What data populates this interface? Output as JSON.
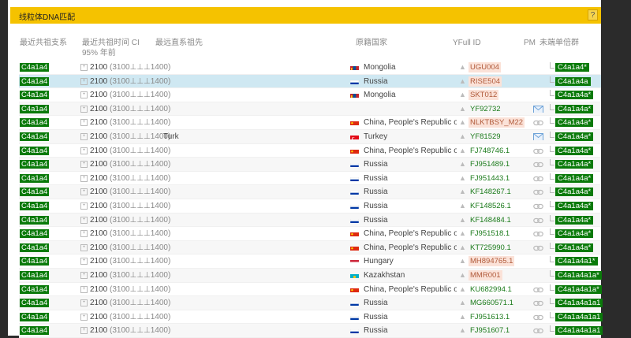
{
  "window": {
    "title": "线粒体DNA匹配",
    "help_label": "?"
  },
  "columns": {
    "haplogroup": "最近共祖支系",
    "tmrca_l1": "最近共祖时间 CI",
    "tmrca_l2": "95% 年前",
    "ancestor": "最远直系祖先",
    "country": "原籍国家",
    "yfull_id": "YFull ID",
    "pm": "PM",
    "subclade": "未端单倍群"
  },
  "colors": {
    "accent": "#f5c200",
    "haplogroup_badge": "#0a7a0a",
    "selected_row": "#cfe8f2",
    "id_highlight": "#fbe2d8"
  },
  "rows": [
    {
      "hap": "C4a1a4",
      "expand": "+",
      "time": "2100",
      "ci_open": "(3100",
      "ci_sep": "⊥⊥⊥",
      "ci_close": "1400)",
      "ancestor": "",
      "flag": "mongolia",
      "country": "Mongolia",
      "id": "UGU004",
      "id_style": "o",
      "pm": "",
      "subclade": "C4a1a4*"
    },
    {
      "hap": "C4a1a4",
      "expand": "+",
      "time": "2100",
      "ci_open": "(3100",
      "ci_sep": "⊥⊥⊥",
      "ci_close": "1400)",
      "ancestor": "",
      "flag": "russia",
      "country": "Russia",
      "id": "RISE504",
      "id_style": "o",
      "pm": "",
      "subclade": "C4a1a4a"
    },
    {
      "hap": "C4a1a4",
      "expand": "+",
      "time": "2100",
      "ci_open": "(3100",
      "ci_sep": "⊥⊥⊥",
      "ci_close": "1400)",
      "ancestor": "",
      "flag": "mongolia",
      "country": "Mongolia",
      "id": "SKT012",
      "id_style": "o",
      "pm": "",
      "subclade": "C4a1a4a*"
    },
    {
      "hap": "C4a1a4",
      "expand": "+",
      "time": "2100",
      "ci_open": "(3100",
      "ci_sep": "⊥⊥⊥",
      "ci_close": "1400)",
      "ancestor": "",
      "flag": "",
      "country": "",
      "id": "YF92732",
      "id_style": "g",
      "pm": "mail",
      "subclade": "C4a1a4a*"
    },
    {
      "hap": "C4a1a4",
      "expand": "+",
      "time": "2100",
      "ci_open": "(3100",
      "ci_sep": "⊥⊥⊥",
      "ci_close": "1400)",
      "ancestor": "",
      "flag": "china",
      "country": "China, People's Republic of",
      "id": "NLKTBSY_M22",
      "id_style": "o",
      "pm": "link",
      "subclade": "C4a1a4a*"
    },
    {
      "hap": "C4a1a4",
      "expand": "+",
      "time": "2100",
      "ci_open": "(3100",
      "ci_sep": "⊥⊥⊥",
      "ci_close": "1400)",
      "ancestor": "Turk",
      "flag": "turkey",
      "country": "Turkey",
      "id": "YF81529",
      "id_style": "g",
      "pm": "mail",
      "subclade": "C4a1a4a*"
    },
    {
      "hap": "C4a1a4",
      "expand": "+",
      "time": "2100",
      "ci_open": "(3100",
      "ci_sep": "⊥⊥⊥",
      "ci_close": "1400)",
      "ancestor": "",
      "flag": "china",
      "country": "China, People's Republic of",
      "id": "FJ748746.1",
      "id_style": "g",
      "pm": "link",
      "subclade": "C4a1a4a*"
    },
    {
      "hap": "C4a1a4",
      "expand": "+",
      "time": "2100",
      "ci_open": "(3100",
      "ci_sep": "⊥⊥⊥",
      "ci_close": "1400)",
      "ancestor": "",
      "flag": "russia",
      "country": "Russia",
      "id": "FJ951489.1",
      "id_style": "g",
      "pm": "link",
      "subclade": "C4a1a4a*"
    },
    {
      "hap": "C4a1a4",
      "expand": "+",
      "time": "2100",
      "ci_open": "(3100",
      "ci_sep": "⊥⊥⊥",
      "ci_close": "1400)",
      "ancestor": "",
      "flag": "russia",
      "country": "Russia",
      "id": "FJ951443.1",
      "id_style": "g",
      "pm": "link",
      "subclade": "C4a1a4a*"
    },
    {
      "hap": "C4a1a4",
      "expand": "+",
      "time": "2100",
      "ci_open": "(3100",
      "ci_sep": "⊥⊥⊥",
      "ci_close": "1400)",
      "ancestor": "",
      "flag": "russia",
      "country": "Russia",
      "id": "KF148267.1",
      "id_style": "g",
      "pm": "link",
      "subclade": "C4a1a4a*"
    },
    {
      "hap": "C4a1a4",
      "expand": "+",
      "time": "2100",
      "ci_open": "(3100",
      "ci_sep": "⊥⊥⊥",
      "ci_close": "1400)",
      "ancestor": "",
      "flag": "russia",
      "country": "Russia",
      "id": "KF148526.1",
      "id_style": "g",
      "pm": "link",
      "subclade": "C4a1a4a*"
    },
    {
      "hap": "C4a1a4",
      "expand": "+",
      "time": "2100",
      "ci_open": "(3100",
      "ci_sep": "⊥⊥⊥",
      "ci_close": "1400)",
      "ancestor": "",
      "flag": "russia",
      "country": "Russia",
      "id": "KF148484.1",
      "id_style": "g",
      "pm": "link",
      "subclade": "C4a1a4a*"
    },
    {
      "hap": "C4a1a4",
      "expand": "+",
      "time": "2100",
      "ci_open": "(3100",
      "ci_sep": "⊥⊥⊥",
      "ci_close": "1400)",
      "ancestor": "",
      "flag": "china",
      "country": "China, People's Republic of",
      "id": "FJ951518.1",
      "id_style": "g",
      "pm": "link",
      "subclade": "C4a1a4a*"
    },
    {
      "hap": "C4a1a4",
      "expand": "+",
      "time": "2100",
      "ci_open": "(3100",
      "ci_sep": "⊥⊥⊥",
      "ci_close": "1400)",
      "ancestor": "",
      "flag": "china",
      "country": "China, People's Republic of",
      "id": "KT725990.1",
      "id_style": "g",
      "pm": "link",
      "subclade": "C4a1a4a*"
    },
    {
      "hap": "C4a1a4",
      "expand": "+",
      "time": "2100",
      "ci_open": "(3100",
      "ci_sep": "⊥⊥⊥",
      "ci_close": "1400)",
      "ancestor": "",
      "flag": "hungary",
      "country": "Hungary",
      "id": "MH894765.1",
      "id_style": "o",
      "pm": "",
      "subclade": "C4a1a4a1*"
    },
    {
      "hap": "C4a1a4",
      "expand": "+",
      "time": "2100",
      "ci_open": "(3100",
      "ci_sep": "⊥⊥⊥",
      "ci_close": "1400)",
      "ancestor": "",
      "flag": "kazakhstan",
      "country": "Kazakhstan",
      "id": "MMR001",
      "id_style": "o",
      "pm": "",
      "subclade": "C4a1a4a1a*"
    },
    {
      "hap": "C4a1a4",
      "expand": "+",
      "time": "2100",
      "ci_open": "(3100",
      "ci_sep": "⊥⊥⊥",
      "ci_close": "1400)",
      "ancestor": "",
      "flag": "china",
      "country": "China, People's Republic of",
      "id": "KU682994.1",
      "id_style": "g",
      "pm": "link",
      "subclade": "C4a1a4a1a*"
    },
    {
      "hap": "C4a1a4",
      "expand": "+",
      "time": "2100",
      "ci_open": "(3100",
      "ci_sep": "⊥⊥⊥",
      "ci_close": "1400)",
      "ancestor": "",
      "flag": "russia",
      "country": "Russia",
      "id": "MG660571.1",
      "id_style": "g",
      "pm": "link",
      "subclade": "C4a1a4a1a1"
    },
    {
      "hap": "C4a1a4",
      "expand": "+",
      "time": "2100",
      "ci_open": "(3100",
      "ci_sep": "⊥⊥⊥",
      "ci_close": "1400)",
      "ancestor": "",
      "flag": "russia",
      "country": "Russia",
      "id": "FJ951613.1",
      "id_style": "g",
      "pm": "link",
      "subclade": "C4a1a4a1a1"
    },
    {
      "hap": "C4a1a4",
      "expand": "+",
      "time": "2100",
      "ci_open": "(3100",
      "ci_sep": "⊥⊥⊥",
      "ci_close": "1400)",
      "ancestor": "",
      "flag": "russia",
      "country": "Russia",
      "id": "FJ951607.1",
      "id_style": "g",
      "pm": "link",
      "subclade": "C4a1a4a1a1"
    }
  ]
}
